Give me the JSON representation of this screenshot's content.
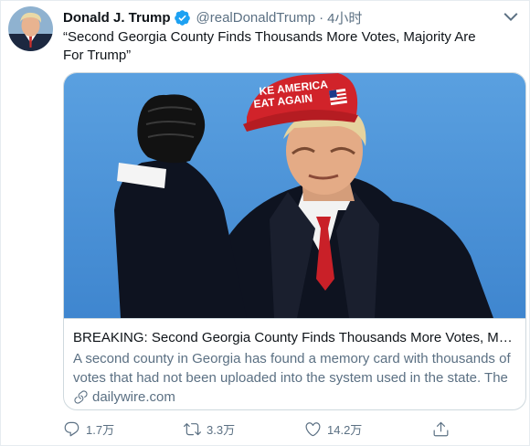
{
  "tweet": {
    "author_name": "Donald J. Trump",
    "handle": "@realDonaldTrump",
    "separator": "·",
    "time": "4小时",
    "text": "“Second Georgia County Finds Thousands More Votes, Majority Are For Trump”"
  },
  "card": {
    "title": "BREAKING: Second Georgia County Finds Thousands More Votes, Majority Are For Trump",
    "description": "A second county in Georgia has found a memory card with thousands of votes that had not been uploaded into the system used in the state. The county is expected to…",
    "domain": "dailywire.com",
    "hat_text": "MAKE AMERICA GREAT AGAIN"
  },
  "actions": {
    "reply_count": "1.7万",
    "retweet_count": "3.3万",
    "like_count": "14.2万"
  },
  "colors": {
    "verified": "#1da1f2",
    "secondary_text": "#5b7083",
    "sky": "#4a90d4",
    "hat_red": "#d1232a"
  },
  "icons": [
    "verified-badge-icon",
    "more-options-icon",
    "link-icon",
    "reply-icon",
    "retweet-icon",
    "like-icon",
    "share-icon"
  ]
}
